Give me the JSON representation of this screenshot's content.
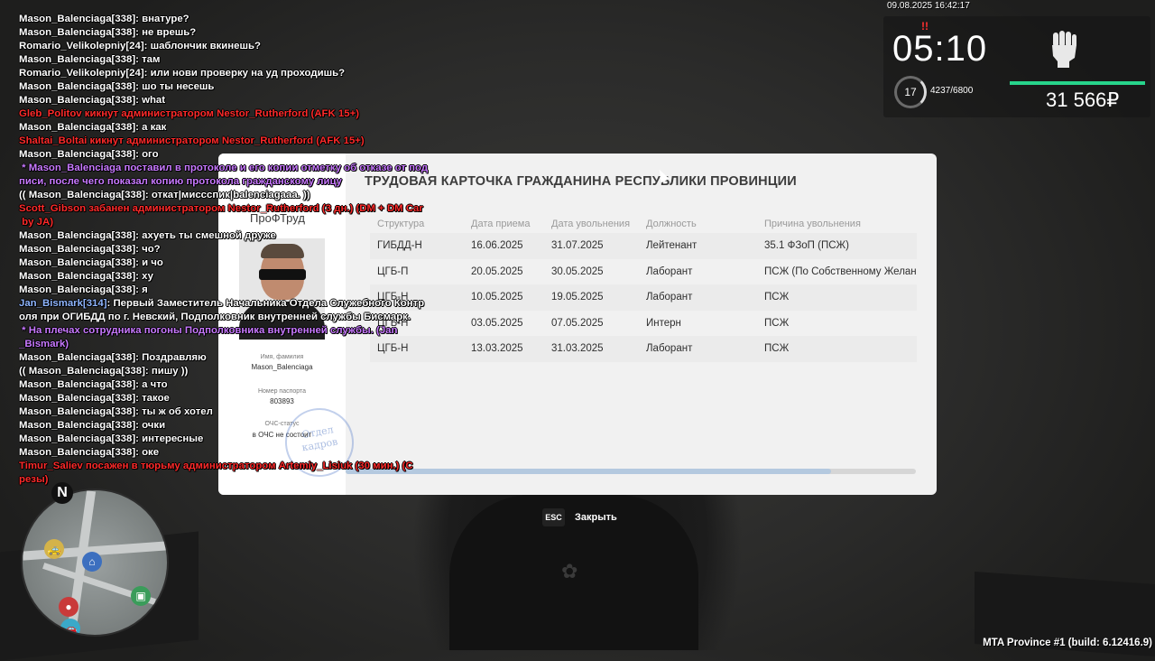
{
  "chat": [
    {
      "text": "Mason_Balenciaga[338]: внатуре?",
      "color": "white"
    },
    {
      "text": "Mason_Balenciaga[338]: не врешь?",
      "color": "white"
    },
    {
      "text": "Romario_Velikolepniy[24]: шаблончик вкинешь?",
      "color": "white"
    },
    {
      "text": "Mason_Balenciaga[338]: там",
      "color": "white"
    },
    {
      "text": "Romario_Velikolepniy[24]: или нови проверку на уд проходишь?",
      "color": "white"
    },
    {
      "text": "Mason_Balenciaga[338]: шо ты несешь",
      "color": "white"
    },
    {
      "text": "Mason_Balenciaga[338]: what",
      "color": "white"
    },
    {
      "text": "Gleb_Politov кикнут администратором Nestor_Rutherford (AFK 15+)",
      "color": "red"
    },
    {
      "text": "Mason_Balenciaga[338]: а как",
      "color": "white"
    },
    {
      "text": "Shaltai_Boltai кикнут администратором Nestor_Rutherford (AFK 15+)",
      "color": "red"
    },
    {
      "text": "Mason_Balenciaga[338]: ого",
      "color": "white"
    },
    {
      "text": " * Mason_Balenciaga поставил в протоколе и его копии отметку об отказе от под\nписи, после чего показал копию протокола гражданскому лицу",
      "color": "purple"
    },
    {
      "text": "(( Mason_Balenciaga[338]: откат|миссспик|balenciagaaa. ))",
      "color": "white"
    },
    {
      "text": "Scott_Gibson забанен администратором Nestor_Rutherford (3 дн.) (DM + DM Car\n by JA)",
      "color": "red"
    },
    {
      "text": "Mason_Balenciaga[338]: ахуеть ты смешной друже",
      "color": "white"
    },
    {
      "text": "Mason_Balenciaga[338]: чо?",
      "color": "white"
    },
    {
      "text": "Mason_Balenciaga[338]: и чо",
      "color": "white"
    },
    {
      "text": "Mason_Balenciaga[338]: ху",
      "color": "white"
    },
    {
      "text": "Mason_Balenciaga[338]: я",
      "color": "white"
    },
    {
      "text": "Jan_Bismark[314]: Первый Заместитель Начальника Отдела Служебного Контр\nоля при ОГИБДД по г. Невский, Подполковник внутренней службы Бисмарк.",
      "color": "blue"
    },
    {
      "text": " * На плечах сотрудника погоны Подполковника внутренней службы. (Jan\n_Bismark)",
      "color": "purple"
    },
    {
      "text": "Mason_Balenciaga[338]: Поздравляю",
      "color": "white"
    },
    {
      "text": "(( Mason_Balenciaga[338]: пишу ))",
      "color": "white"
    },
    {
      "text": "Mason_Balenciaga[338]: а что",
      "color": "white"
    },
    {
      "text": "Mason_Balenciaga[338]: такое",
      "color": "white"
    },
    {
      "text": "Mason_Balenciaga[338]: ты ж об хотел",
      "color": "white"
    },
    {
      "text": "Mason_Balenciaga[338]: очки",
      "color": "white"
    },
    {
      "text": "Mason_Balenciaga[338]: интересные",
      "color": "white"
    },
    {
      "text": "Mason_Balenciaga[338]: оке",
      "color": "white"
    },
    {
      "text": "Timur_Saliev посажен в тюрьму администратором Artemiy_Lisiuk (30 мин.) (С\nрезы)",
      "color": "red"
    }
  ],
  "hud": {
    "datetime": "09.08.2025 16:42:17",
    "alert": "!!",
    "clock": "05:10",
    "level": "17",
    "exp": "4237/6800",
    "money": "31 566₽",
    "accent": "#27d48b"
  },
  "minimap": {
    "north_label": "N"
  },
  "card": {
    "side_title": "ПроФТруд",
    "name_label": "Имя, фамилия",
    "name_value": "Mason_Balenciaga",
    "passport_label": "Номер паспорта",
    "passport_value": "803893",
    "ochs_label": "ОЧС-статус",
    "ochs_value": "в ОЧС не состоит",
    "stamp_line1": "Отдел",
    "stamp_line2": "кадров",
    "title": "ТРУДОВАЯ КАРТОЧКА ГРАЖДАНИНА РЕСПУБЛИКИ ПРОВИНЦИИ",
    "columns": [
      "Структура",
      "Дата приема",
      "Дата увольнения",
      "Должность",
      "Причина увольнения"
    ],
    "rows": [
      [
        "ГИБДД-Н",
        "16.06.2025",
        "31.07.2025",
        "Лейтенант",
        "35.1 ФЗоП (ПСЖ)"
      ],
      [
        "ЦГБ-П",
        "20.05.2025",
        "30.05.2025",
        "Лаборант",
        "ПСЖ (По Собственному Желанию)"
      ],
      [
        "ЦГБ-Н",
        "10.05.2025",
        "19.05.2025",
        "Лаборант",
        "ПСЖ"
      ],
      [
        "ЦГБ-Н",
        "03.05.2025",
        "07.05.2025",
        "Интерн",
        "ПСЖ"
      ],
      [
        "ЦГБ-Н",
        "13.03.2025",
        "31.03.2025",
        "Лаборант",
        "ПСЖ"
      ]
    ]
  },
  "close": {
    "key": "ESC",
    "label": "Закрыть"
  },
  "build": "MTA Province #1 (build: 6.12416.9)"
}
